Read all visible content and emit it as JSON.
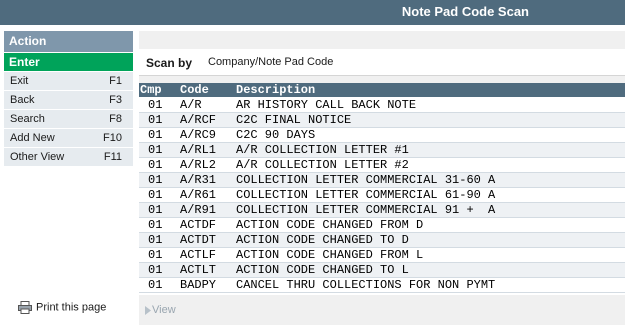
{
  "window": {
    "title": "Note Pad Code Scan"
  },
  "sidebar": {
    "header": "Action",
    "enter": "Enter",
    "items": [
      {
        "label": "Exit",
        "key": "F1"
      },
      {
        "label": "Back",
        "key": "F3"
      },
      {
        "label": "Search",
        "key": "F8"
      },
      {
        "label": "Add New",
        "key": "F10"
      },
      {
        "label": "Other View",
        "key": "F11"
      }
    ],
    "print_label": "Print this page"
  },
  "scan": {
    "label": "Scan by",
    "value": "Company/Note Pad Code"
  },
  "table": {
    "headers": {
      "cmp": "Cmp",
      "code": "Code",
      "description": "Description"
    },
    "rows": [
      {
        "cmp": "01",
        "code": "A/R",
        "description": "AR HISTORY CALL BACK NOTE"
      },
      {
        "cmp": "01",
        "code": "A/RCF",
        "description": "C2C FINAL NOTICE"
      },
      {
        "cmp": "01",
        "code": "A/RC9",
        "description": "C2C 90 DAYS"
      },
      {
        "cmp": "01",
        "code": "A/RL1",
        "description": "A/R COLLECTION LETTER #1"
      },
      {
        "cmp": "01",
        "code": "A/RL2",
        "description": "A/R COLLECTION LETTER #2"
      },
      {
        "cmp": "01",
        "code": "A/R31",
        "description": "COLLECTION LETTER COMMERCIAL 31-60 A"
      },
      {
        "cmp": "01",
        "code": "A/R61",
        "description": "COLLECTION LETTER COMMERCIAL 61-90 A"
      },
      {
        "cmp": "01",
        "code": "A/R91",
        "description": "COLLECTION LETTER COMMERCIAL 91 +  A"
      },
      {
        "cmp": "01",
        "code": "ACTDF",
        "description": "ACTION CODE CHANGED FROM D"
      },
      {
        "cmp": "01",
        "code": "ACTDT",
        "description": "ACTION CODE CHANGED TO D"
      },
      {
        "cmp": "01",
        "code": "ACTLF",
        "description": "ACTION CODE CHANGED FROM L"
      },
      {
        "cmp": "01",
        "code": "ACTLT",
        "description": "ACTION CODE CHANGED TO L"
      },
      {
        "cmp": "01",
        "code": "BADPY",
        "description": "CANCEL THRU COLLECTIONS FOR NON PYMT"
      }
    ]
  },
  "view_bar": {
    "label": "View"
  },
  "icons": {
    "print": "printer-icon",
    "view": "triangle-right-icon"
  },
  "colors": {
    "title_bar": "#4f6b7e",
    "action_header": "#7f97ab",
    "enter": "#00a35a",
    "menu_bg": "#e6ebef"
  }
}
